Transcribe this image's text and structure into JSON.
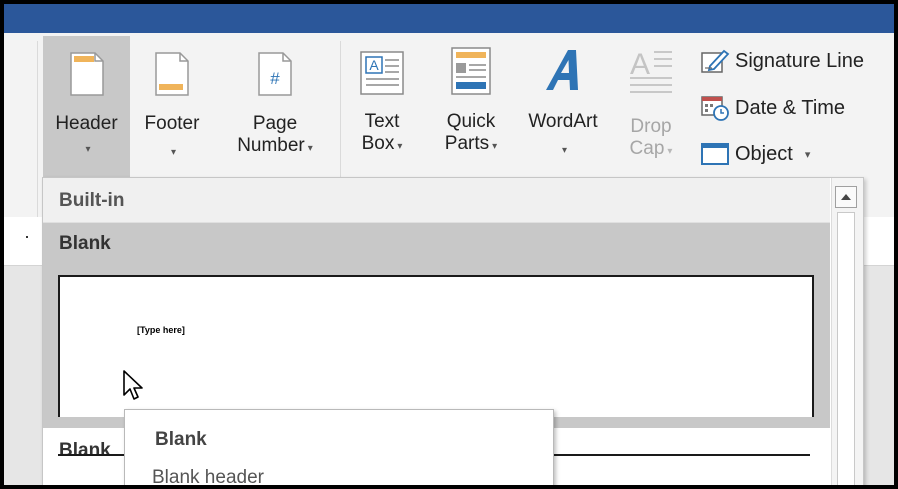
{
  "ribbon": {
    "header": {
      "label": "Header",
      "arrow": "▾"
    },
    "footer": {
      "label": "Footer",
      "arrow": "▾"
    },
    "page_number": {
      "line1": "Page",
      "line2": "Number",
      "arrow": "▾"
    },
    "text_box": {
      "line1": "Text",
      "line2": "Box",
      "arrow": "▾"
    },
    "quick_parts": {
      "line1": "Quick",
      "line2": "Parts",
      "arrow": "▾"
    },
    "wordart": {
      "label": "WordArt",
      "arrow": "▾"
    },
    "drop_cap": {
      "line1": "Drop",
      "line2": "Cap",
      "arrow": "▾"
    },
    "signature_line": {
      "label": "Signature Line"
    },
    "date_time": {
      "label": "Date & Time"
    },
    "object": {
      "label": "Object",
      "arrow": "▾"
    }
  },
  "dropdown": {
    "section_label": "Built-in",
    "items": [
      {
        "title": "Blank",
        "preview_text": "[Type here]"
      },
      {
        "title": "Blank"
      }
    ]
  },
  "tooltip": {
    "title": "Blank",
    "description": "Blank header"
  },
  "colors": {
    "titlebar": "#2b579a",
    "accent_orange": "#f0b45a",
    "accent_blue": "#2e74b5",
    "selected_gray": "#c8c8c8"
  }
}
